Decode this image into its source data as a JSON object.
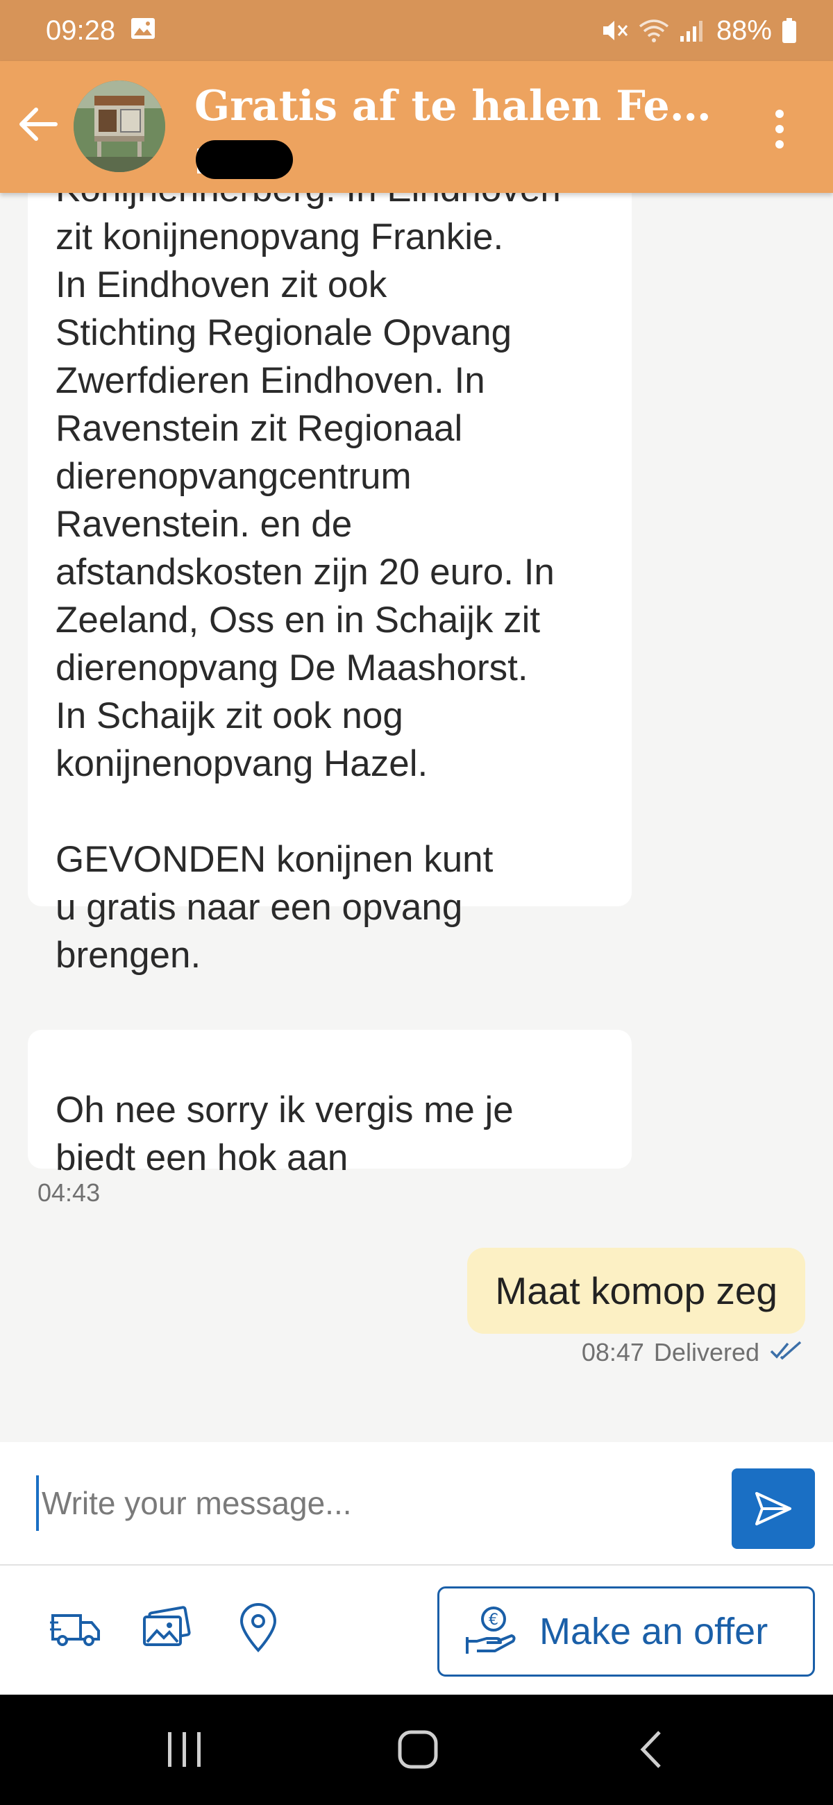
{
  "status_bar": {
    "time": "09:28",
    "battery": "88%",
    "icons": [
      "image-icon",
      "mute-icon",
      "wifi-icon",
      "signal-icon",
      "battery-icon"
    ]
  },
  "header": {
    "title": "Gratis af te halen Ferpl...",
    "subtitle_redacted": true
  },
  "messages": {
    "incoming": [
      {
        "text": "Konijnenherberg. In Eindhoven\nzit konijnenopvang Frankie.\nIn Eindhoven zit ook\nStichting Regionale Opvang\nZwerfdieren Eindhoven. In\nRavenstein zit Regionaal\ndierenopvangcentrum\nRavenstein. en de\nafstandskosten zijn 20 euro. In\nZeeland, Oss en in Schaijk zit\ndierenopvang De Maashorst.\nIn Schaijk zit ook nog\nkonijnenopvang Hazel.\n\nGEVONDEN konijnen kunt\nu gratis naar een opvang\nbrengen."
      },
      {
        "text": "Oh nee sorry ik vergis me je\nbiedt een hok aan"
      }
    ],
    "incoming_time": "04:43",
    "outgoing": {
      "text": "Maat komop zeg",
      "time": "08:47",
      "status": "Delivered"
    }
  },
  "composer": {
    "placeholder": "Write your message..."
  },
  "actions": {
    "offer_label": "Make an offer",
    "icons": [
      "delivery-truck-icon",
      "photos-icon",
      "location-pin-icon"
    ]
  },
  "colors": {
    "status_bar": "#d79458",
    "header": "#eda35f",
    "accent_blue": "#1a6fc4",
    "outgoing_bubble": "#fcf0c4"
  }
}
